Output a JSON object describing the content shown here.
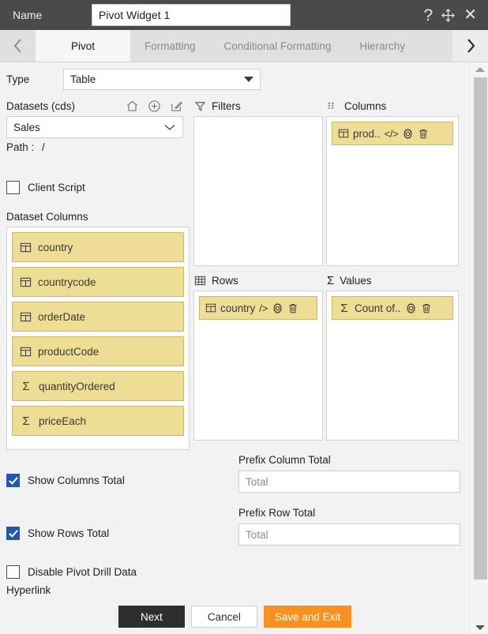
{
  "titlebar": {
    "label": "Name",
    "widget_name": "Pivot Widget 1",
    "help_icon": "question-mark-icon",
    "move_icon": "move-cross-icon",
    "close_icon": "close-x-icon"
  },
  "tabs": {
    "prev_icon": "chevron-left-icon",
    "next_icon": "chevron-right-icon",
    "items": [
      {
        "label": "Pivot",
        "active": true
      },
      {
        "label": "Formatting",
        "active": false
      },
      {
        "label": "Conditional Formatting",
        "active": false
      },
      {
        "label": "Hierarchy",
        "active": false
      }
    ]
  },
  "type_row": {
    "label": "Type",
    "value": "Table"
  },
  "datasets": {
    "title": "Datasets (cds)",
    "home_icon": "home-icon",
    "add_icon": "plus-circle-icon",
    "edit_icon": "edit-pencil-icon",
    "value": "Sales",
    "path_label": "Path :",
    "path_value": "/"
  },
  "client_script": {
    "label": "Client Script",
    "checked": false
  },
  "dataset_columns": {
    "title": "Dataset Columns",
    "items": [
      {
        "label": "country",
        "icon": "table-column-icon"
      },
      {
        "label": "countrycode",
        "icon": "table-column-icon"
      },
      {
        "label": "orderDate",
        "icon": "table-column-icon"
      },
      {
        "label": "productCode",
        "icon": "table-column-icon"
      },
      {
        "label": "quantityOrdered",
        "icon": "sigma-icon"
      },
      {
        "label": "priceEach",
        "icon": "sigma-icon"
      }
    ]
  },
  "filters": {
    "title": "Filters",
    "icon": "funnel-filter-icon",
    "items": []
  },
  "columns": {
    "title": "Columns",
    "icon": "columns-list-icon",
    "items": [
      {
        "label": "prod..",
        "field_icon": "table-column-icon",
        "code_icon": "</>",
        "settings_icon": "gear-icon",
        "delete_icon": "trash-icon"
      }
    ]
  },
  "rows": {
    "title": "Rows",
    "icon": "table-grid-icon",
    "items": [
      {
        "label": "country",
        "field_icon": "table-column-icon",
        "code_icon": "/>",
        "settings_icon": "gear-icon",
        "delete_icon": "trash-icon"
      }
    ]
  },
  "values": {
    "title": "Values",
    "icon": "sigma-icon",
    "items": [
      {
        "label": "Count of..",
        "field_icon": "sigma-icon",
        "code_icon": "",
        "settings_icon": "gear-icon",
        "delete_icon": "trash-icon"
      }
    ]
  },
  "options": {
    "show_columns_total": {
      "label": "Show Columns Total",
      "checked": true
    },
    "show_rows_total": {
      "label": "Show Rows Total",
      "checked": true
    },
    "disable_pivot_drill": {
      "label": "Disable Pivot Drill Data",
      "checked": false
    },
    "hyperlink_label": "Hyperlink"
  },
  "prefix_column_total": {
    "label": "Prefix Column Total",
    "value": "",
    "placeholder": "Total"
  },
  "prefix_row_total": {
    "label": "Prefix Row Total",
    "value": "",
    "placeholder": "Total"
  },
  "footer": {
    "next": "Next",
    "cancel": "Cancel",
    "save": "Save and Exit"
  },
  "scrollbar": {
    "up_icon": "scroll-up-arrow-icon",
    "down_icon": "scroll-down-arrow-icon"
  },
  "colors": {
    "titlebar_bg": "#4a4a4a",
    "chip_bg": "#eedd94",
    "chip_border": "#c9b96a",
    "accent_orange": "#f79122",
    "checkbox_blue": "#2658a8",
    "panel_bg": "#f2f2f2"
  }
}
